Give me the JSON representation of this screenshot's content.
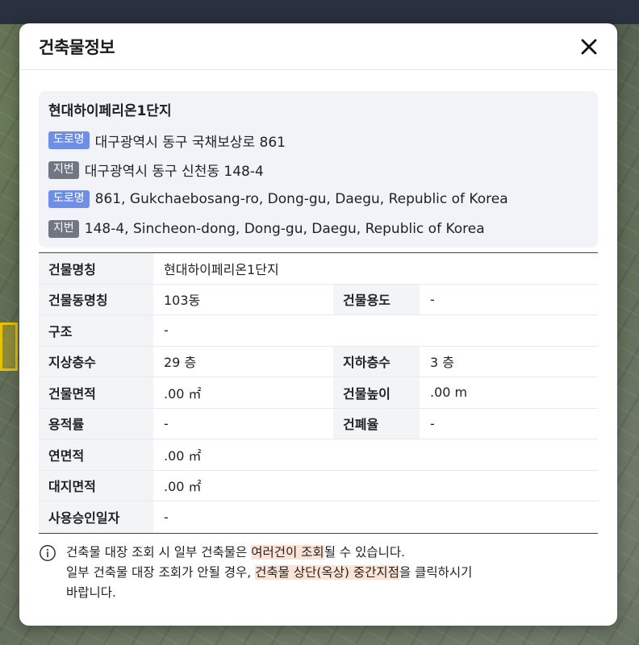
{
  "modal": {
    "title": "건축물정보",
    "building_name": "현대하이페리온1단지",
    "addresses": [
      {
        "tag": "도로명",
        "type": "road",
        "text": "대구광역시 동구 국채보상로 861"
      },
      {
        "tag": "지번",
        "type": "lot",
        "text": "대구광역시 동구 신천동 148-4"
      },
      {
        "tag": "도로명",
        "type": "road",
        "text": "861, Gukchaebosang-ro, Dong-gu, Daegu, Republic of Korea"
      },
      {
        "tag": "지번",
        "type": "lot",
        "text": "148-4, Sincheon-dong, Dong-gu, Daegu, Republic of Korea"
      }
    ],
    "table": {
      "building_name_label": "건물명칭",
      "building_name_value": "현대하이페리온1단지",
      "dong_name_label": "건물동명칭",
      "dong_name_value": "103동",
      "usage_label": "건물용도",
      "usage_value": "-",
      "structure_label": "구조",
      "structure_value": "-",
      "above_floors_label": "지상층수",
      "above_floors_value": "29 층",
      "below_floors_label": "지하층수",
      "below_floors_value": "3 층",
      "area_label": "건물면적",
      "area_value": ".00 ㎡",
      "height_label": "건물높이",
      "height_value": ".00 m",
      "far_label": "용적률",
      "far_value": "-",
      "bcr_label": "건폐율",
      "bcr_value": "-",
      "total_area_label": "연면적",
      "total_area_value": ".00 ㎡",
      "land_area_label": "대지면적",
      "land_area_value": ".00 ㎡",
      "approval_date_label": "사용승인일자",
      "approval_date_value": "-"
    },
    "note": {
      "line1_a": "건축물 대장 조회 시 일부 건축물은 ",
      "line1_hl": "여러건이 조회",
      "line1_b": "될 수 있습니다.",
      "line2_a": "일부 건축물 대장 조회가 안될 경우, ",
      "line2_hl": "건축물 상단(옥상) 중간지점",
      "line2_b": "을 클릭하시기",
      "line3": "바랍니다."
    }
  },
  "colors": {
    "road_tag": "#6f8ee6",
    "lot_tag": "#707783",
    "highlight": "#fde3d5",
    "address_box_bg": "#f1f3f9"
  },
  "icons": {
    "close": "close-icon",
    "info": "info-circle-icon"
  }
}
